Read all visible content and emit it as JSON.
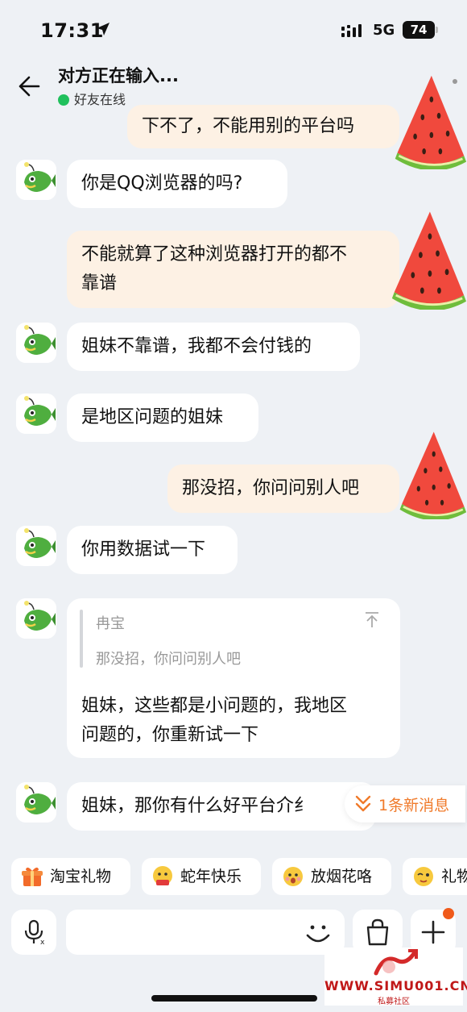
{
  "status": {
    "time": "17:31",
    "network": "5G",
    "battery": "74"
  },
  "header": {
    "title": "对方正在输入...",
    "subtitle": "好友在线"
  },
  "messages": [
    {
      "side": "right",
      "text": "下不了，不能用别的平台吗"
    },
    {
      "side": "left",
      "text": "你是QQ浏览器的吗?"
    },
    {
      "side": "right",
      "line1": "不能就算了这种浏览器打开的都不",
      "line2": "靠谱"
    },
    {
      "side": "left",
      "text": "姐妹不靠谱，我都不会付钱的"
    },
    {
      "side": "left",
      "text": "是地区问题的姐妹"
    },
    {
      "side": "right",
      "text": "那没招，你问问别人吧"
    },
    {
      "side": "left",
      "text": "你用数据试一下"
    },
    {
      "side": "left",
      "quote_name": "冉宝",
      "quote_text": "那没招，你问问别人吧",
      "line1": "姐妹，这些都是小问题的，我地区",
      "line2": "问题的，你重新试一下"
    },
    {
      "side": "left",
      "text": "姐妹，那你有什么好平台介纟"
    }
  ],
  "new_messages": "1条新消息",
  "quick_chips": [
    "淘宝礼物",
    "蛇年快乐",
    "放烟花咯",
    "礼物"
  ],
  "watermark": {
    "main": "WWW.SIMU001.CN",
    "sub": "私募社区"
  },
  "colors": {
    "accent": "#f07a2a",
    "online": "#20c05c",
    "bubble_right": "#fdf1e4"
  }
}
